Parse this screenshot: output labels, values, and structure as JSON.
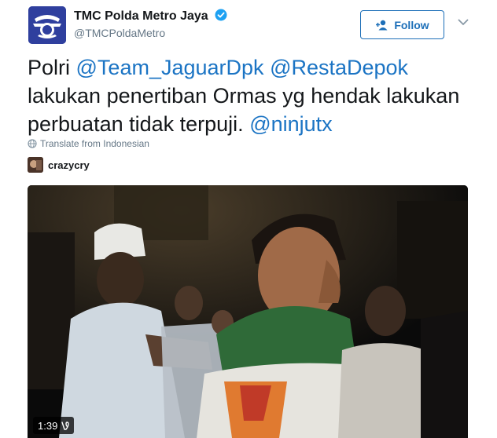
{
  "header": {
    "display_name": "TMC Polda Metro Jaya",
    "handle": "@TMCPoldaMetro",
    "follow_label": "Follow"
  },
  "tweet": {
    "segments": [
      {
        "text": "Polri ",
        "mention": false
      },
      {
        "text": "@Team_JaguarDpk",
        "mention": true
      },
      {
        "text": " ",
        "mention": false
      },
      {
        "text": "@RestaDepok",
        "mention": true
      },
      {
        "text": " lakukan penertiban Ormas yg hendak lakukan perbuatan tidak terpuji.  ",
        "mention": false
      },
      {
        "text": "@ninjutx",
        "mention": true
      }
    ],
    "translate_label": "Translate from Indonesian",
    "attribution_name": "crazycry"
  },
  "video": {
    "duration": "1:39"
  },
  "colors": {
    "mention": "#1b74c4",
    "follow_border": "#1d6fb8",
    "avatar_bg": "#2f3f9e",
    "verified": "#1da1f2"
  },
  "icons": {
    "verified": "verified-badge-icon",
    "follow": "add-person-icon",
    "menu": "chevron-down-icon",
    "translate": "globe-icon",
    "video_badge": "vine-icon"
  }
}
